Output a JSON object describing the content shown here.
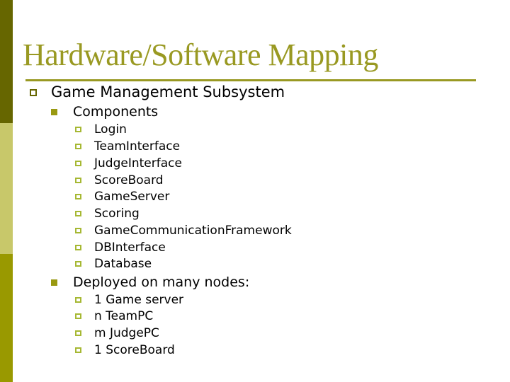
{
  "slide": {
    "title": "Hardware/Software Mapping",
    "colors": {
      "accent": "#999922",
      "bar_dark": "#666600",
      "bar_light": "#c8c86a",
      "bar_bright": "#999900"
    },
    "bullet_icons": [
      "hollow-square-icon",
      "filled-square-icon",
      "hollow-square-icon"
    ],
    "level1": {
      "text": "Game Management Subsystem"
    },
    "components": {
      "heading": "Components",
      "items": [
        "Login",
        "TeamInterface",
        "JudgeInterface",
        "ScoreBoard",
        "GameServer",
        "Scoring",
        "GameCommunicationFramework",
        "DBInterface",
        "Database"
      ]
    },
    "deployment": {
      "heading": "Deployed on many nodes:",
      "items": [
        "1 Game server",
        "n TeamPC",
        "m JudgePC",
        "1 ScoreBoard"
      ]
    }
  }
}
